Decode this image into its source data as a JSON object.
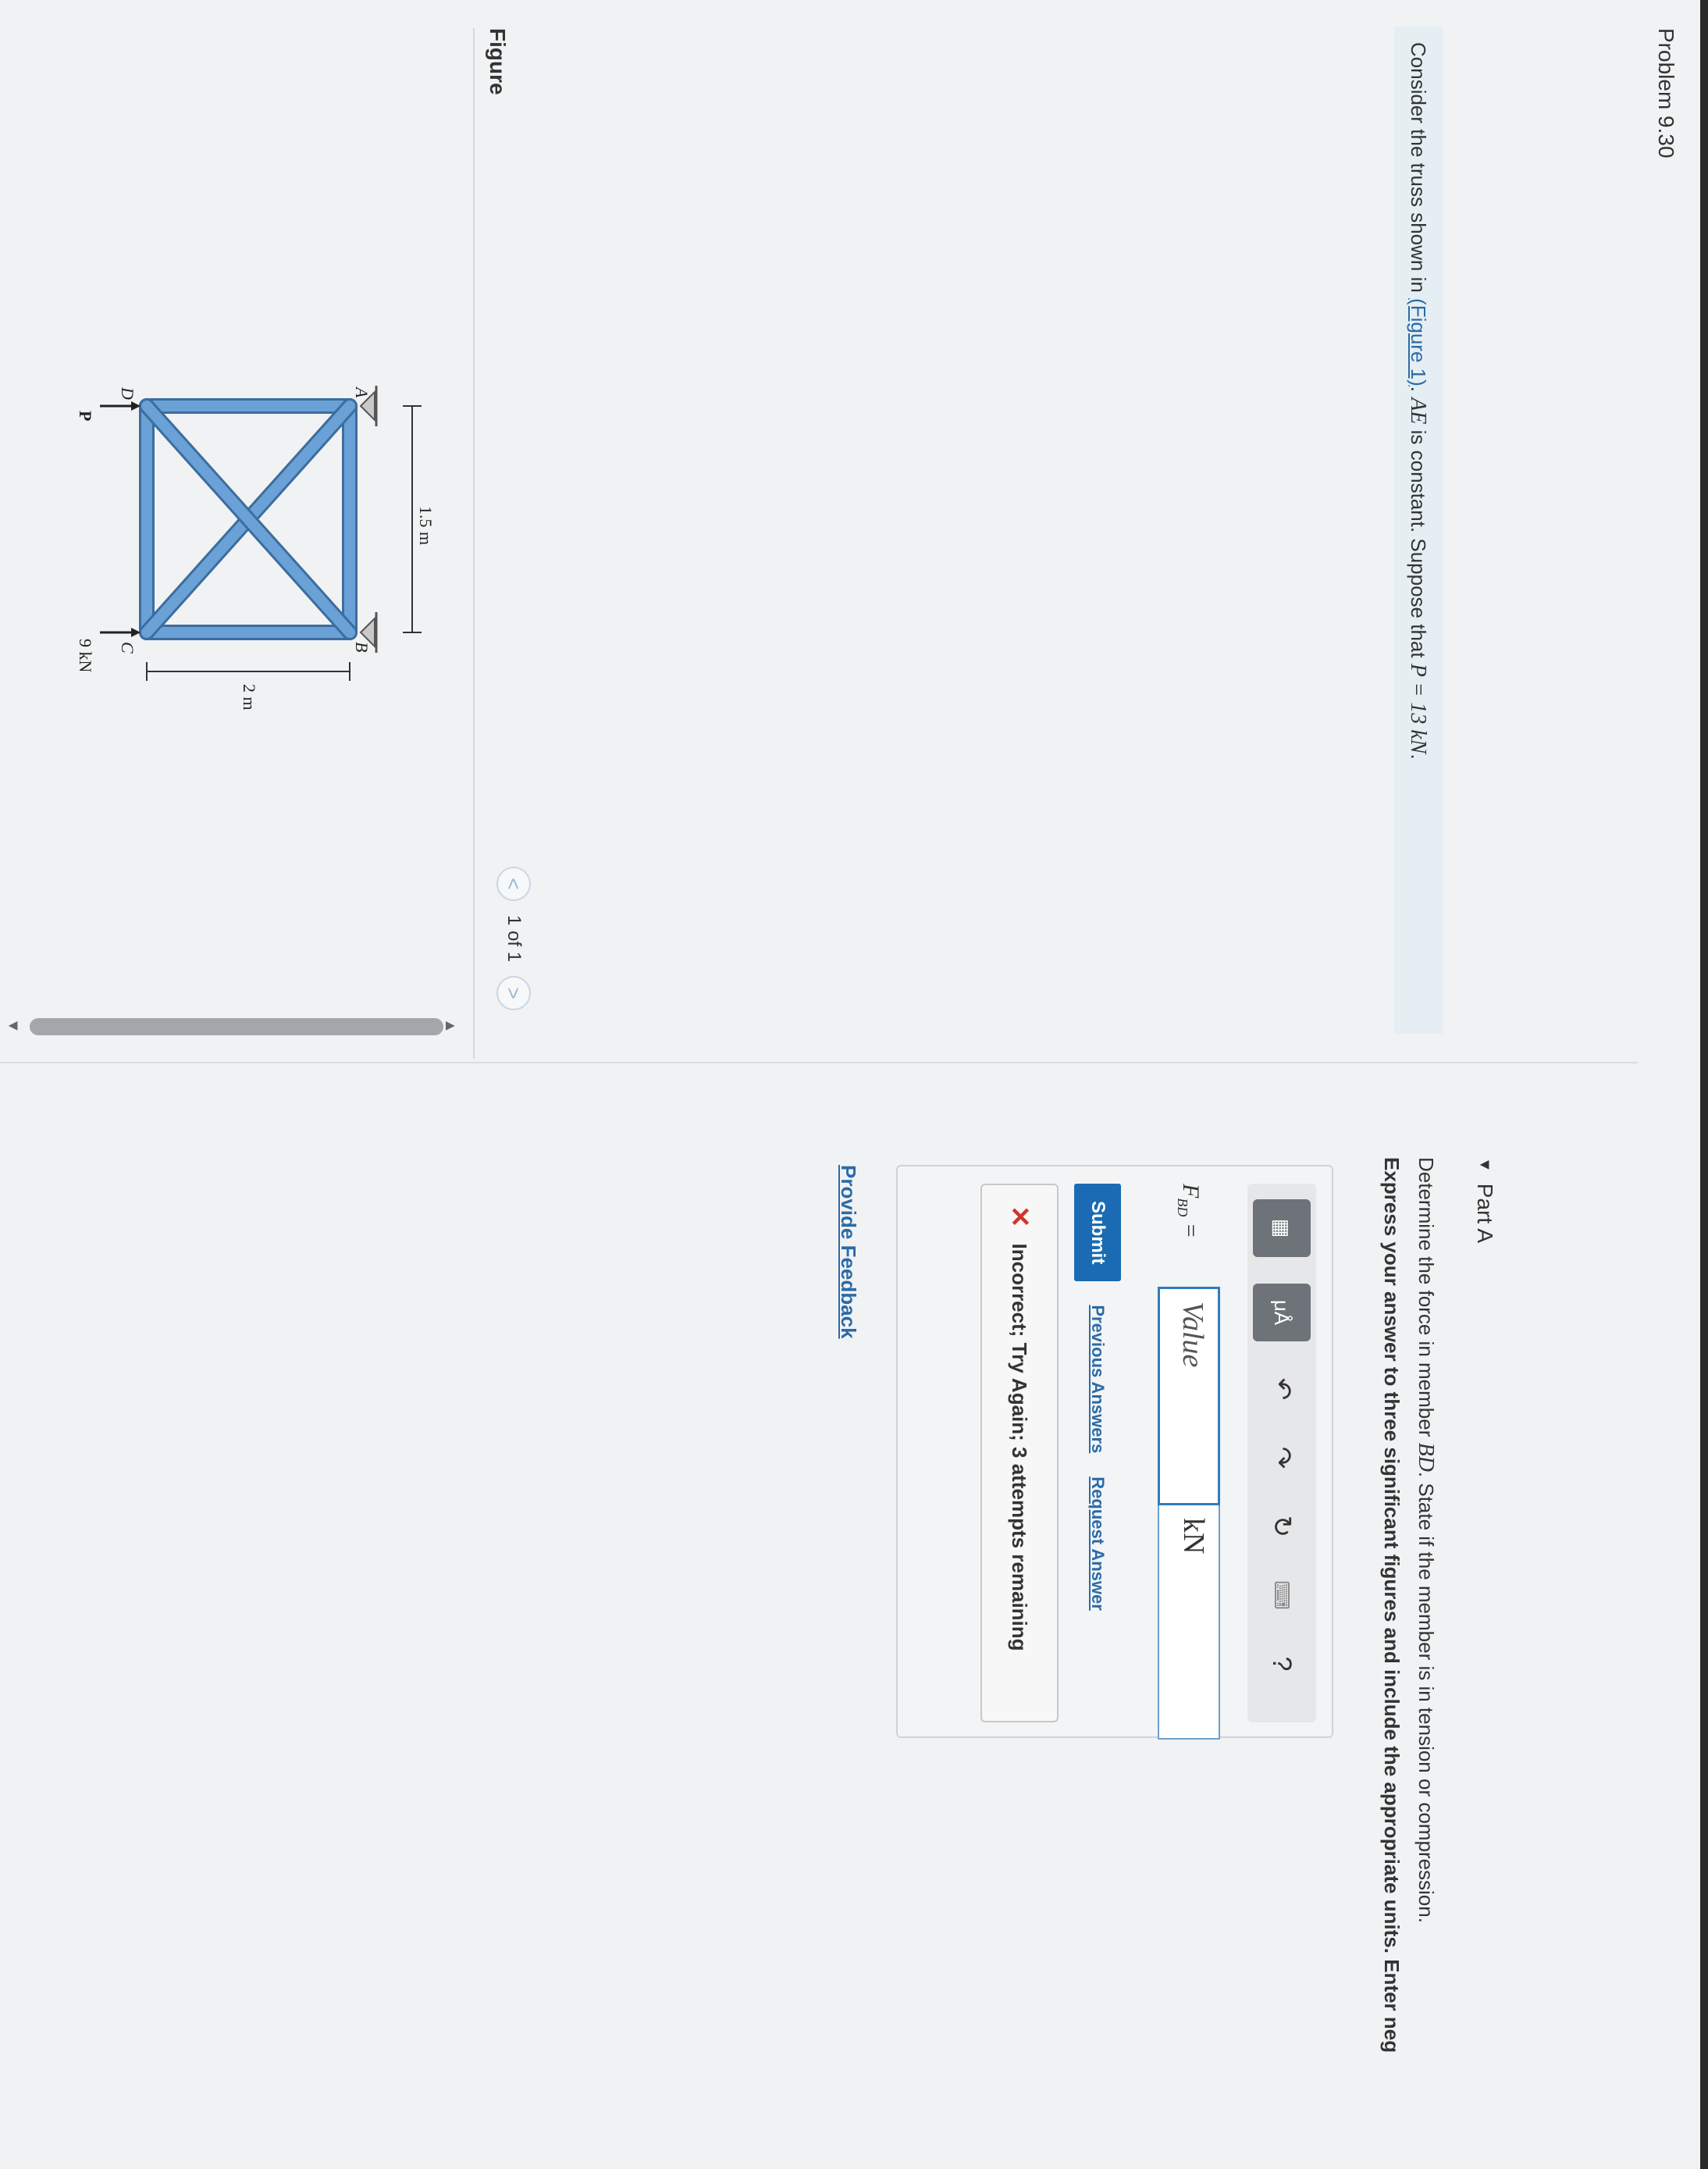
{
  "problem": {
    "title": "Problem 9.30"
  },
  "prompt": {
    "pre": "Consider the truss shown in ",
    "figure_link": "(Figure 1)",
    "mid": ". ",
    "ae": "AE",
    "post": " is constant. Suppose that ",
    "p_expr": "P = 13 kN",
    "end": "."
  },
  "figure": {
    "label": "Figure",
    "pager": {
      "prev": "<",
      "text": "1 of 1",
      "next": ">"
    },
    "truss": {
      "node_a": "A",
      "node_b": "B",
      "node_c": "C",
      "node_d": "D",
      "load_p": "P",
      "load_c": "9 kN",
      "dim_w": "1.5 m",
      "dim_h": "2 m"
    }
  },
  "part": {
    "title": "Part A",
    "q1_pre": "Determine the force in member ",
    "q1_member": "BD",
    "q1_post": ". State if the member is in tension or compression.",
    "q2": "Express your answer to three significant figures and include the appropriate units. Enter neg"
  },
  "answer": {
    "var_main": "F",
    "var_sub": "BD",
    "equals": " =",
    "value_placeholder": "Value",
    "unit": "kN",
    "toolbar": {
      "templates_icon": "▦",
      "mu_label": "μÅ",
      "undo_icon": "↶",
      "redo_icon": "↷",
      "reset_icon": "↻",
      "keyboard_icon": "⌨",
      "help_icon": "?"
    }
  },
  "actions": {
    "submit": "Submit",
    "previous": "Previous Answers",
    "request": "Request Answer"
  },
  "feedback": {
    "icon": "✕",
    "text": "Incorrect; Try Again; 3 attempts remaining"
  },
  "provide_feedback": "Provide Feedback",
  "colors": {
    "member": "#5b93c9",
    "member_edge": "#3c6d9e",
    "submit": "#1a6bb3",
    "error": "#d0342c"
  }
}
